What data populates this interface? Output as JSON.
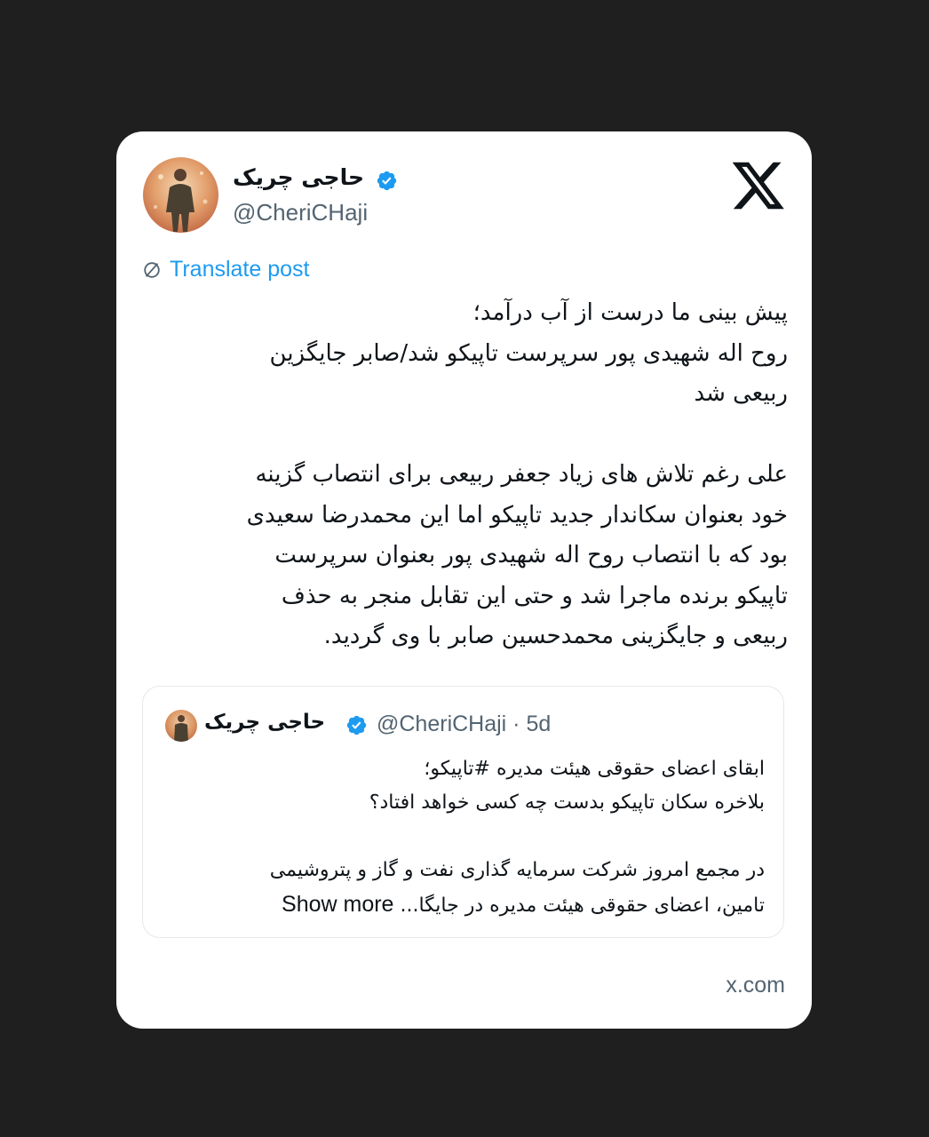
{
  "tweet": {
    "display_name": "حاجی چریک",
    "handle": "@CheriCHaji",
    "translate_label": "Translate post",
    "paragraph_1": [
      "پیش بینی ما درست از آب درآمد؛",
      "روح اله شهیدی پور سرپرست تاپیکو شد/صابر جایگزین",
      "ربیعی شد"
    ],
    "paragraph_2": [
      "علی رغم تلاش های زیاد جعفر ربیعی برای انتصاب گزینه",
      "خود بعنوان سکاندار جدید تاپیکو اما این محمدرضا سعیدی",
      "بود که با انتصاب روح اله شهیدی پور بعنوان سرپرست",
      "تاپیکو برنده ماجرا شد و حتی این تقابل منجر به حذف",
      "ربیعی و جایگزینی محمدحسین صابر با وی گردید."
    ]
  },
  "quoted": {
    "display_name": "حاجی چریک",
    "handle_time": "@CheriCHaji · 5d",
    "paragraph_1": [
      "ابقای اعضای حقوقی هیئت مدیره #تاپیکو؛",
      "بلاخره سکان تاپیکو بدست چه کسی خواهد افتاد؟"
    ],
    "paragraph_2": [
      "در مجمع امروز شرکت سرمایه گذاری نفت و گاز و پتروشیمی",
      "تامین، اعضای حقوقی هیئت مدیره در جایگا..."
    ],
    "show_more": "Show more"
  },
  "footer": {
    "site": "x.com"
  },
  "icons": {
    "verified": "verified-badge-icon",
    "logo": "x-logo-icon",
    "translate": "globe-icon"
  },
  "colors": {
    "background": "#1f1f1f",
    "card": "#ffffff",
    "link": "#1d9bf0",
    "verified": "#1d9bf0",
    "text": "#0f1419",
    "muted": "#536471"
  }
}
